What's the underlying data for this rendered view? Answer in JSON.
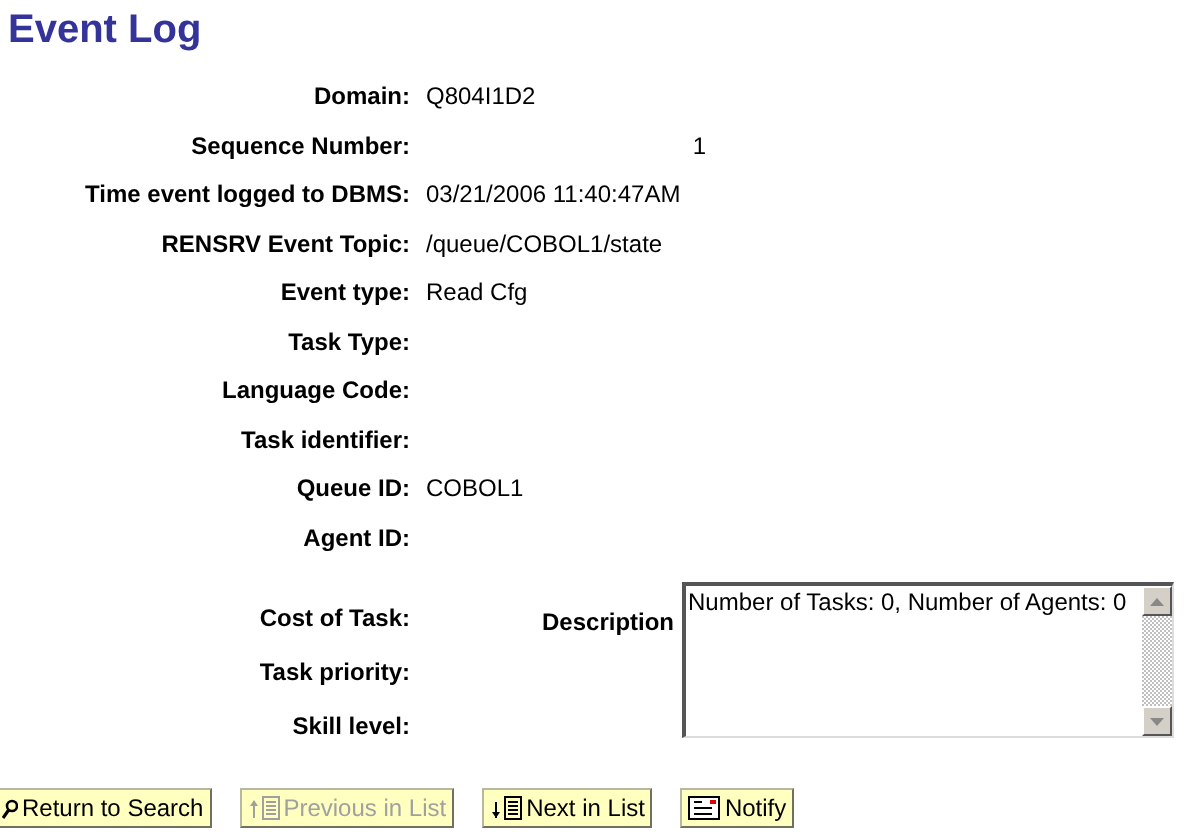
{
  "title": "Event Log",
  "fields": [
    {
      "label": "Domain:",
      "value": "Q804I1D2",
      "kind": "text"
    },
    {
      "label": "Sequence Number:",
      "value": "1",
      "kind": "number"
    },
    {
      "label": "Time event logged to DBMS:",
      "value": "03/21/2006 11:40:47AM",
      "kind": "text"
    },
    {
      "label": "RENSRV Event Topic:",
      "value": "/queue/COBOL1/state",
      "kind": "text"
    },
    {
      "label": "Event type:",
      "value": "Read Cfg",
      "kind": "text"
    },
    {
      "label": "Task Type:"
    },
    {
      "label": "Language Code:"
    },
    {
      "label": "Task identifier:"
    },
    {
      "label": "Queue ID:",
      "value": "COBOL1",
      "kind": "text"
    },
    {
      "label": "Agent ID:"
    }
  ],
  "lower_fields": [
    {
      "label": "Cost of Task:"
    },
    {
      "label": "Task priority:"
    },
    {
      "label": "Skill level:"
    }
  ],
  "description": {
    "label": "Description",
    "value": "Number of Tasks: 0, Number of Agents: 0"
  },
  "buttons": [
    {
      "label": "Return to Search",
      "kind": "search",
      "disabled": false
    },
    {
      "label": "Previous in List",
      "kind": "up",
      "disabled": true
    },
    {
      "label": "Next in List",
      "kind": "down",
      "disabled": false
    },
    {
      "label": "Notify",
      "kind": "notify",
      "disabled": false
    }
  ]
}
